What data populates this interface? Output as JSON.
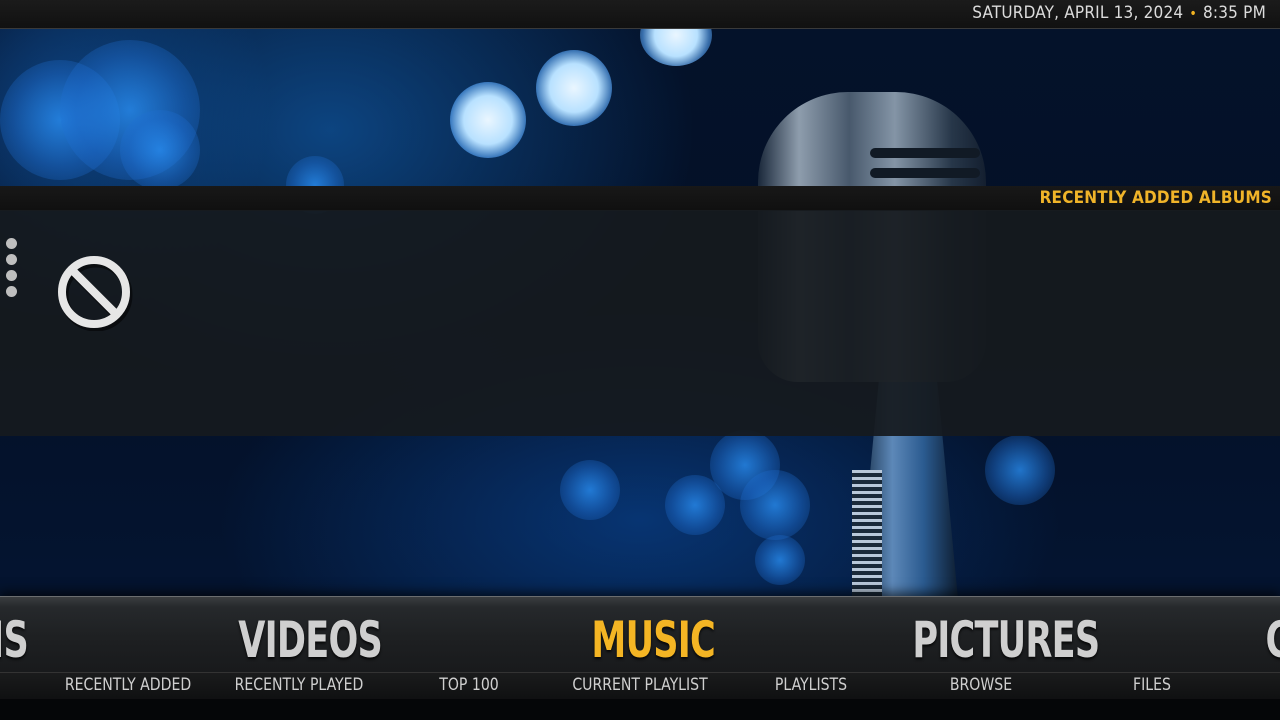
{
  "header": {
    "date": "SATURDAY, APRIL 13, 2024",
    "separator": "•",
    "time": "8:35 PM"
  },
  "section": {
    "title": "RECENTLY ADDED ALBUMS",
    "empty_icon": "no-content-icon",
    "options_icon": "vertical-dots-icon"
  },
  "menu": {
    "items": [
      {
        "label": "IS",
        "state": "partial"
      },
      {
        "label": "VIDEOS",
        "state": "normal"
      },
      {
        "label": "MUSIC",
        "state": "selected"
      },
      {
        "label": "PICTURES",
        "state": "normal"
      },
      {
        "label": "C",
        "state": "partial"
      }
    ],
    "submenu": [
      "RECENTLY ADDED",
      "RECENTLY PLAYED",
      "TOP 100",
      "CURRENT PLAYLIST",
      "PLAYLISTS",
      "BROWSE",
      "FILES"
    ]
  },
  "colors": {
    "accent": "#f4b524",
    "text": "#cfcfcf"
  }
}
